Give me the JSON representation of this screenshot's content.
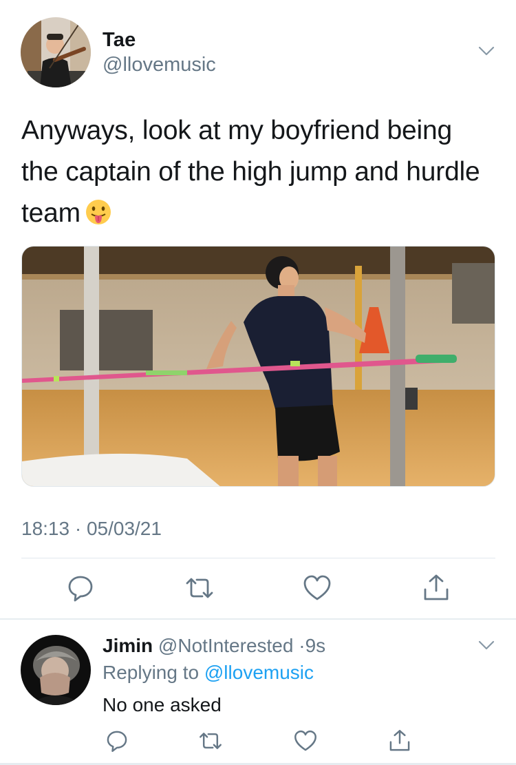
{
  "tweet": {
    "author_name": "Tae",
    "author_handle": "@llovemusic",
    "text": "Anyways, look at my boyfriend being the captain of the high jump and hurdle team",
    "emoji": "face-with-tongue",
    "timestamp": "18:13 · 05/03/21",
    "actions": [
      "reply",
      "retweet",
      "like",
      "share"
    ]
  },
  "reply": {
    "author_name": "Jimin",
    "author_handle": "@NotInterested",
    "time_sep": "·",
    "time": "9s",
    "replying_prefix": "Replying to",
    "replying_handle": "@llovemusic",
    "text": "No one asked"
  },
  "colors": {
    "text_primary": "#14171a",
    "text_secondary": "#657786",
    "link": "#1da1f2",
    "divider": "#e1e8ed"
  }
}
